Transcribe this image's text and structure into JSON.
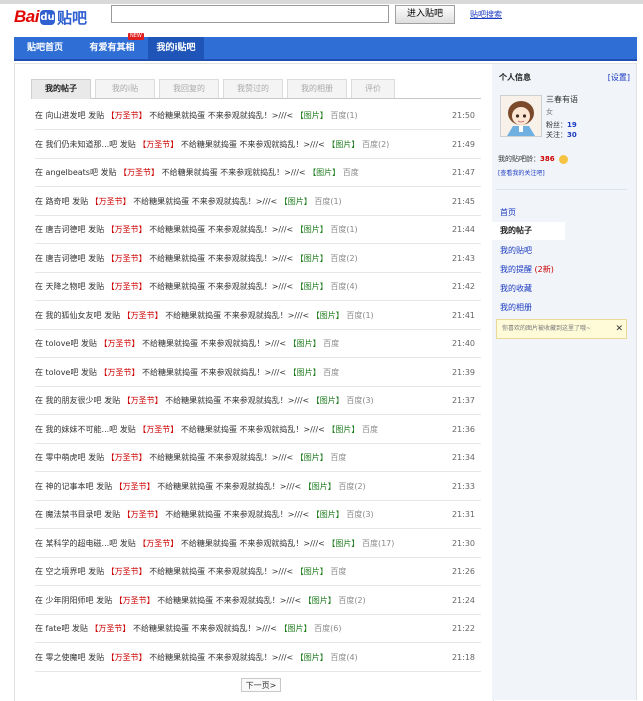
{
  "header": {
    "logo_bai": "Bai",
    "logo_du": "du",
    "logo_tieba": "贴吧",
    "search_value": "",
    "search_button": "进入贴吧",
    "search_link": "贴吧搜索"
  },
  "nav": {
    "items": [
      "贴吧首页",
      "有爱有其相",
      "我的i贴吧"
    ],
    "badge": "NEW"
  },
  "tabs": [
    "我的帖子",
    "我的i贴",
    "我回复的",
    "我赞过的",
    "我的相册",
    "评价"
  ],
  "rows": [
    {
      "prefix": "在",
      "forum": "向山进发吧",
      "verb": "发贴",
      "tag": "【万圣节】",
      "body": "不给糖果就捣蛋 不来参观就捣乱！>///<",
      "pic": "【图片】",
      "pub": "百度(1)",
      "time": "21:50"
    },
    {
      "prefix": "在",
      "forum": "我们仍未知道那...吧",
      "verb": "发贴",
      "tag": "【万圣节】",
      "body": "不给糖果就捣蛋 不来参观就捣乱！>///<",
      "pic": "【图片】",
      "pub": "百度(2)",
      "time": "21:49"
    },
    {
      "prefix": "在",
      "forum": "angelbeats吧",
      "verb": "发贴",
      "tag": "【万圣节】",
      "body": "不给糖果就捣蛋 不来参观就捣乱！>///<",
      "pic": "【图片】",
      "pub": "百度",
      "time": "21:47"
    },
    {
      "prefix": "在",
      "forum": "路奇吧",
      "verb": "发贴",
      "tag": "【万圣节】",
      "body": "不给糖果就捣蛋 不来参观就捣乱！>///<",
      "pic": "【图片】",
      "pub": "百度(1)",
      "time": "21:45"
    },
    {
      "prefix": "在",
      "forum": "唐吉诃德吧",
      "verb": "发贴",
      "tag": "【万圣节】",
      "body": "不给糖果就捣蛋 不来参观就捣乱！>///<",
      "pic": "【图片】",
      "pub": "百度(1)",
      "time": "21:44"
    },
    {
      "prefix": "在",
      "forum": "唐吉诃德吧",
      "verb": "发贴",
      "tag": "【万圣节】",
      "body": "不给糖果就捣蛋 不来参观就捣乱！>///<",
      "pic": "【图片】",
      "pub": "百度(2)",
      "time": "21:43"
    },
    {
      "prefix": "在",
      "forum": "天降之物吧",
      "verb": "发贴",
      "tag": "【万圣节】",
      "body": "不给糖果就捣蛋 不来参观就捣乱！>///<",
      "pic": "【图片】",
      "pub": "百度(4)",
      "time": "21:42"
    },
    {
      "prefix": "在",
      "forum": "我的狐仙女友吧",
      "verb": "发贴",
      "tag": "【万圣节】",
      "body": "不给糖果就捣蛋 不来参观就捣乱！>///<",
      "pic": "【图片】",
      "pub": "百度(1)",
      "time": "21:41"
    },
    {
      "prefix": "在",
      "forum": "tolove吧",
      "verb": "发贴",
      "tag": "【万圣节】",
      "body": "不给糖果就捣蛋 不来参观就捣乱！>///<",
      "pic": "【图片】",
      "pub": "百度",
      "time": "21:40"
    },
    {
      "prefix": "在",
      "forum": "tolove吧",
      "verb": "发贴",
      "tag": "【万圣节】",
      "body": "不给糖果就捣蛋 不来参观就捣乱！>///<",
      "pic": "【图片】",
      "pub": "百度",
      "time": "21:39"
    },
    {
      "prefix": "在",
      "forum": "我的朋友很少吧",
      "verb": "发贴",
      "tag": "【万圣节】",
      "body": "不给糖果就捣蛋 不来参观就捣乱！>///<",
      "pic": "【图片】",
      "pub": "百度(3)",
      "time": "21:37"
    },
    {
      "prefix": "在",
      "forum": "我的妹妹不可能...吧",
      "verb": "发贴",
      "tag": "【万圣节】",
      "body": "不给糖果就捣蛋 不来参观就捣乱！>///<",
      "pic": "【图片】",
      "pub": "百度",
      "time": "21:36"
    },
    {
      "prefix": "在",
      "forum": "零中萌虎吧",
      "verb": "发贴",
      "tag": "【万圣节】",
      "body": "不给糖果就捣蛋 不来参观就捣乱！>///<",
      "pic": "【图片】",
      "pub": "百度",
      "time": "21:34"
    },
    {
      "prefix": "在",
      "forum": "神的记事本吧",
      "verb": "发贴",
      "tag": "【万圣节】",
      "body": "不给糖果就捣蛋 不来参观就捣乱！>///<",
      "pic": "【图片】",
      "pub": "百度(2)",
      "time": "21:33"
    },
    {
      "prefix": "在",
      "forum": "魔法禁书目录吧",
      "verb": "发贴",
      "tag": "【万圣节】",
      "body": "不给糖果就捣蛋 不来参观就捣乱！>///<",
      "pic": "【图片】",
      "pub": "百度(3)",
      "time": "21:31"
    },
    {
      "prefix": "在",
      "forum": "某科学的超电磁...吧",
      "verb": "发贴",
      "tag": "【万圣节】",
      "body": "不给糖果就捣蛋 不来参观就捣乱！>///<",
      "pic": "【图片】",
      "pub": "百度(17)",
      "time": "21:30"
    },
    {
      "prefix": "在",
      "forum": "空之境界吧",
      "verb": "发贴",
      "tag": "【万圣节】",
      "body": "不给糖果就捣蛋 不来参观就捣乱！>///<",
      "pic": "【图片】",
      "pub": "百度",
      "time": "21:26"
    },
    {
      "prefix": "在",
      "forum": "少年阴阳师吧",
      "verb": "发贴",
      "tag": "【万圣节】",
      "body": "不给糖果就捣蛋 不来参观就捣乱！>///<",
      "pic": "【图片】",
      "pub": "百度(2)",
      "time": "21:24"
    },
    {
      "prefix": "在",
      "forum": "fate吧",
      "verb": "发贴",
      "tag": "【万圣节】",
      "body": "不给糖果就捣蛋 不来参观就捣乱！>///<",
      "pic": "【图片】",
      "pub": "百度(6)",
      "time": "21:22"
    },
    {
      "prefix": "在",
      "forum": "零之使魔吧",
      "verb": "发贴",
      "tag": "【万圣节】",
      "body": "不给糖果就捣蛋 不来参观就捣乱！>///<",
      "pic": "【图片】",
      "pub": "百度(4)",
      "time": "21:18"
    }
  ],
  "pagination": {
    "next": "下一页>"
  },
  "sidebar": {
    "title": "个人信息",
    "edit": "[设置]",
    "username": "三春有语",
    "gender": "女",
    "fans_label": "粉丝：",
    "fans": "19",
    "follow_label": "关注：",
    "follow": "30",
    "age_label": "我的贴吧龄：",
    "age_value": "386",
    "follow_link": "[查看我的关注吧]",
    "menu": [
      "首页",
      "我的帖子",
      "我的贴吧",
      "我的提醒",
      "我的收藏",
      "我的相册"
    ],
    "remind_count": "(2新)",
    "tip": "你喜欢的图片被收藏到这里了哦~",
    "tip_close": "✕"
  },
  "colors": {
    "nav_blue": "#2f6fd5",
    "link_blue": "#1a3ac0",
    "accent_red": "#c00"
  }
}
